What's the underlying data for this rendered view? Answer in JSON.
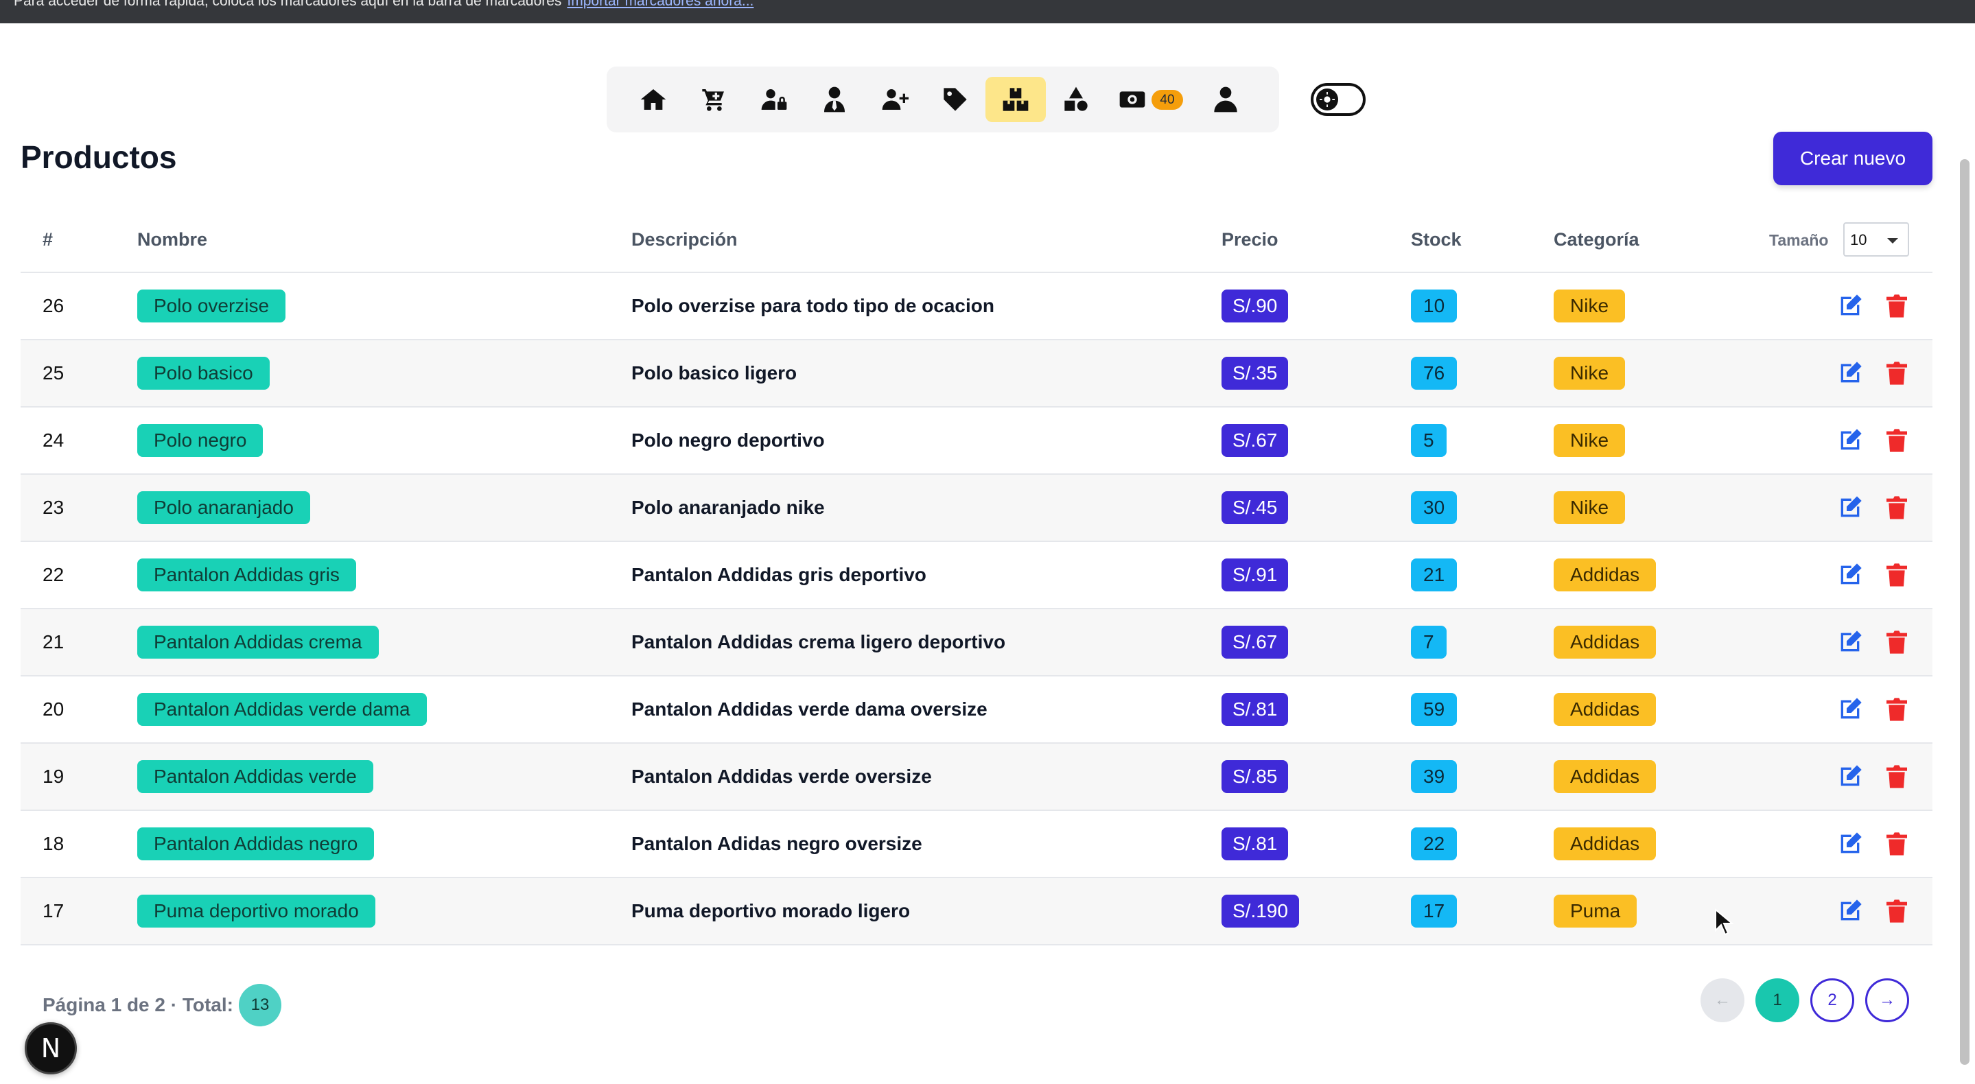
{
  "bookmarks_bar": {
    "text": "Para acceder de forma rápida, coloca los marcadores aquí en la barra de marcadores",
    "link": "Importar marcadores ahora..."
  },
  "nav": {
    "items": [
      {
        "icon": "home-icon",
        "active": false
      },
      {
        "icon": "cart-plus-icon",
        "active": false
      },
      {
        "icon": "user-lock-icon",
        "active": false
      },
      {
        "icon": "user-tie-icon",
        "active": false
      },
      {
        "icon": "user-plus-icon",
        "active": false
      },
      {
        "icon": "tag-icon",
        "active": false
      },
      {
        "icon": "boxes-icon",
        "active": true
      },
      {
        "icon": "shapes-icon",
        "active": false
      },
      {
        "icon": "money-bill-icon",
        "active": false,
        "badge": "40"
      },
      {
        "icon": "user-icon",
        "active": false
      }
    ]
  },
  "header": {
    "title": "Productos",
    "create_button": "Crear nuevo"
  },
  "table": {
    "columns": [
      "#",
      "Nombre",
      "Descripción",
      "Precio",
      "Stock",
      "Categoría"
    ],
    "size_label": "Tamaño",
    "size_value": "10",
    "rows": [
      {
        "id": "26",
        "name": "Polo overzise",
        "description": "Polo overzise para todo tipo de ocacion",
        "price": "S/.90",
        "stock": "10",
        "category": "Nike"
      },
      {
        "id": "25",
        "name": "Polo basico",
        "description": "Polo basico ligero",
        "price": "S/.35",
        "stock": "76",
        "category": "Nike"
      },
      {
        "id": "24",
        "name": "Polo negro",
        "description": "Polo negro deportivo",
        "price": "S/.67",
        "stock": "5",
        "category": "Nike"
      },
      {
        "id": "23",
        "name": "Polo anaranjado",
        "description": "Polo anaranjado nike",
        "price": "S/.45",
        "stock": "30",
        "category": "Nike"
      },
      {
        "id": "22",
        "name": "Pantalon Addidas gris",
        "description": "Pantalon Addidas gris deportivo",
        "price": "S/.91",
        "stock": "21",
        "category": "Addidas"
      },
      {
        "id": "21",
        "name": "Pantalon Addidas crema",
        "description": "Pantalon Addidas crema ligero deportivo",
        "price": "S/.67",
        "stock": "7",
        "category": "Addidas"
      },
      {
        "id": "20",
        "name": "Pantalon Addidas verde dama",
        "description": "Pantalon Addidas verde dama oversize",
        "price": "S/.81",
        "stock": "59",
        "category": "Addidas"
      },
      {
        "id": "19",
        "name": "Pantalon Addidas verde",
        "description": "Pantalon Addidas verde oversize",
        "price": "S/.85",
        "stock": "39",
        "category": "Addidas"
      },
      {
        "id": "18",
        "name": "Pantalon Addidas negro",
        "description": "Pantalon Adidas negro oversize",
        "price": "S/.81",
        "stock": "22",
        "category": "Addidas"
      },
      {
        "id": "17",
        "name": "Puma deportivo morado",
        "description": "Puma deportivo morado ligero",
        "price": "S/.190",
        "stock": "17",
        "category": "Puma"
      }
    ]
  },
  "footer": {
    "page_info": "Página 1 de 2 · Total:",
    "total": "13",
    "pages": [
      "1",
      "2"
    ],
    "prev": "←",
    "next": "→"
  },
  "next_logo": "N",
  "colors": {
    "accent": "#3f2ad8",
    "name_pill": "#19d1b6",
    "stock_pill": "#14b8f5",
    "category_pill": "#fbbf24",
    "edit_icon": "#2563eb",
    "delete_icon": "#ef2a2a"
  }
}
